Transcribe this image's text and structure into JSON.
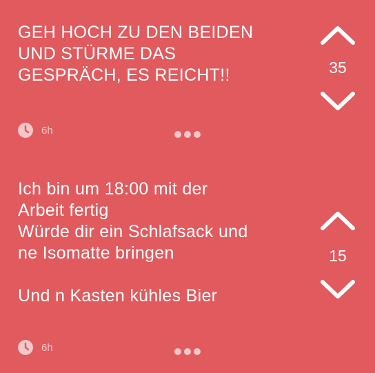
{
  "posts": [
    {
      "text": "GEH HOCH ZU DEN BEIDEN\nUND STÜRME DAS\nGESPRÄCH, ES REICHT!!",
      "score": "35",
      "time": "6h",
      "icons": {
        "upvote": "chevron-up-icon",
        "downvote": "chevron-down-icon",
        "time": "clock-icon",
        "more": "more-dots-icon"
      }
    },
    {
      "text": "Ich bin um 18:00 mit der\nArbeit fertig\nWürde dir ein Schlafsack und\nne Isomatte bringen\n\nUnd n Kasten kühles Bier",
      "score": "15",
      "time": "6h",
      "icons": {
        "upvote": "chevron-up-icon",
        "downvote": "chevron-down-icon",
        "time": "clock-icon",
        "more": "more-dots-icon"
      }
    }
  ],
  "colors": {
    "background": "#e05a5e",
    "text": "#ffffff",
    "muted": "#f6c7c8"
  }
}
